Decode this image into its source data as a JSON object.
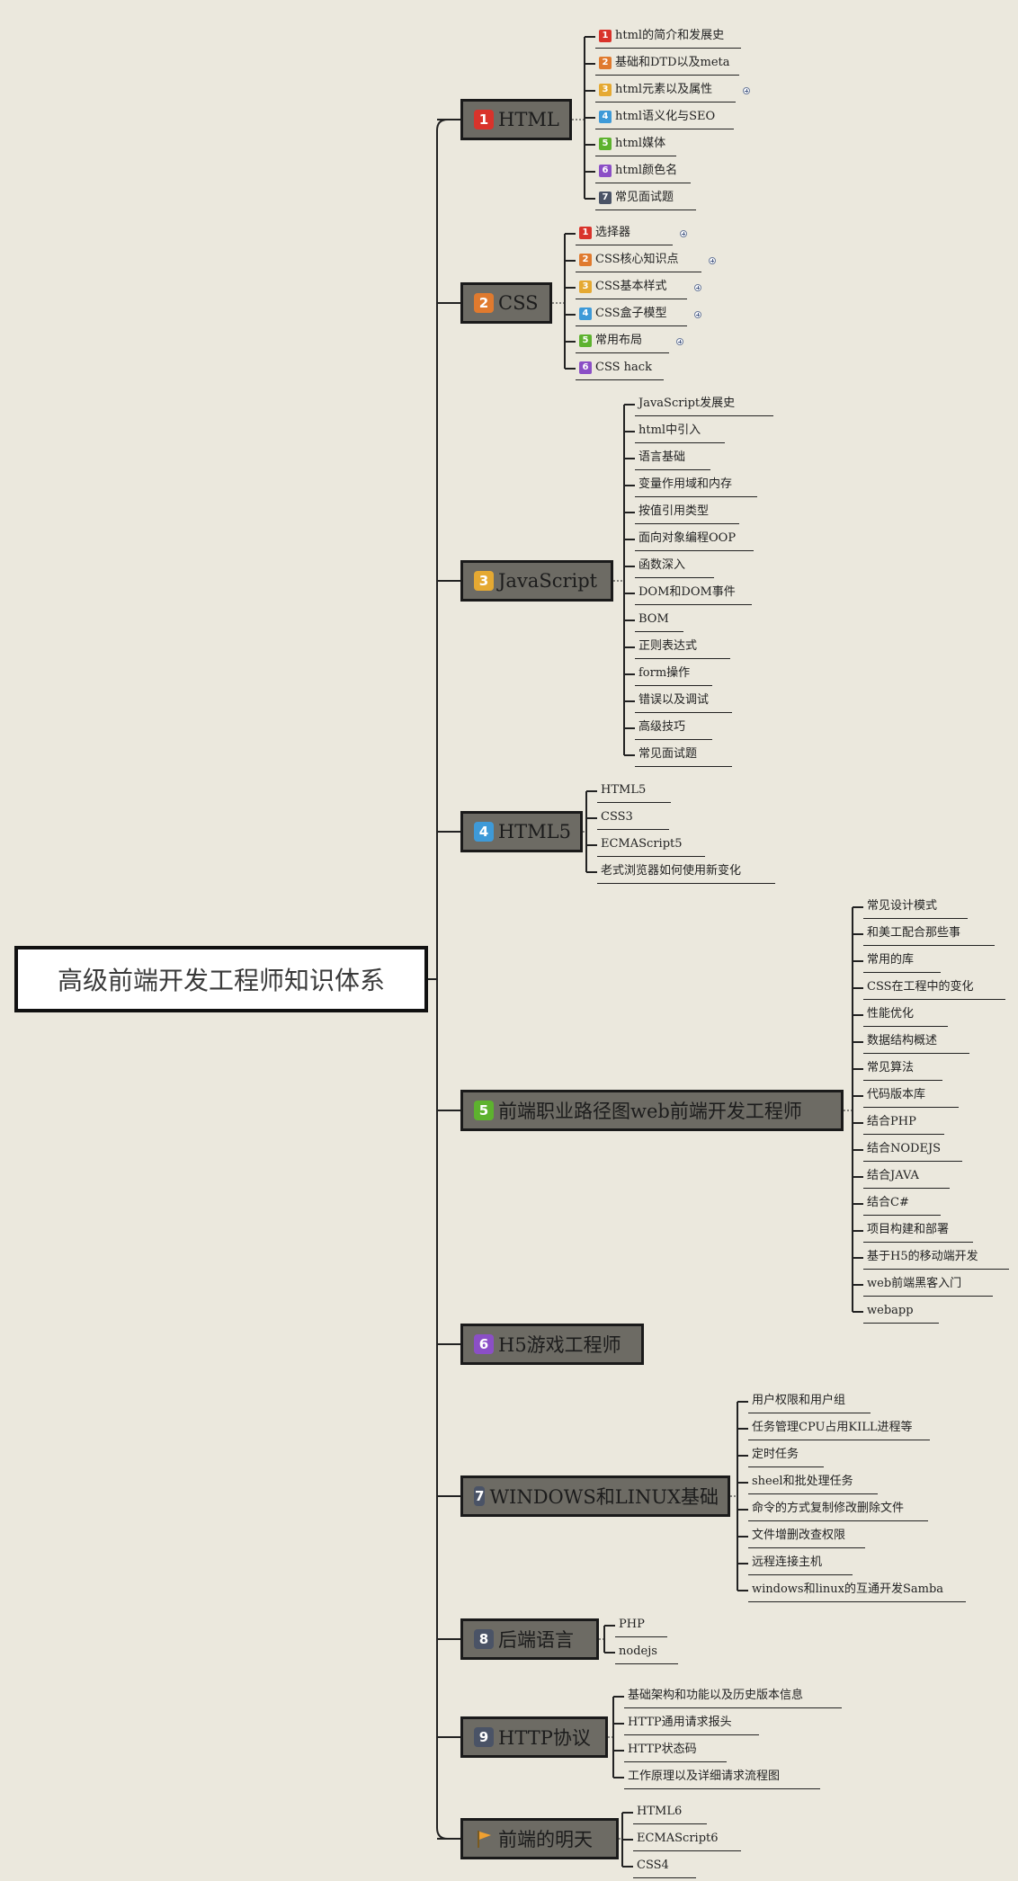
{
  "root": {
    "title": "高级前端开发工程师知识体系"
  },
  "colors": {
    "background": "#ebe8dd",
    "branch_fill": "#6d6b64",
    "line": "#222222",
    "badge": [
      "#d9332b",
      "#e07a2e",
      "#e5a932",
      "#3e9ad8",
      "#5db22e",
      "#8b4fc6",
      "#4a5366",
      "#4a5366",
      "#4a5366"
    ],
    "flag": "#f0a030"
  },
  "branches": [
    {
      "num": "1",
      "label": "HTML",
      "children": [
        {
          "num": "1",
          "label": "html的简介和发展史"
        },
        {
          "num": "2",
          "label": "基础和DTD以及meta"
        },
        {
          "num": "3",
          "label": "html元素以及属性",
          "expandable": true
        },
        {
          "num": "4",
          "label": "html语义化与SEO"
        },
        {
          "num": "5",
          "label": "html媒体"
        },
        {
          "num": "6",
          "label": "html颜色名"
        },
        {
          "num": "7",
          "label": "常见面试题"
        }
      ]
    },
    {
      "num": "2",
      "label": "CSS",
      "children": [
        {
          "num": "1",
          "label": "选择器",
          "expandable": true
        },
        {
          "num": "2",
          "label": "CSS核心知识点",
          "expandable": true
        },
        {
          "num": "3",
          "label": "CSS基本样式",
          "expandable": true
        },
        {
          "num": "4",
          "label": "CSS盒子模型",
          "expandable": true
        },
        {
          "num": "5",
          "label": "常用布局",
          "expandable": true
        },
        {
          "num": "6",
          "label": "CSS hack"
        }
      ]
    },
    {
      "num": "3",
      "label": "JavaScript",
      "children": [
        {
          "label": "JavaScript发展史"
        },
        {
          "label": "html中引入"
        },
        {
          "label": "语言基础"
        },
        {
          "label": "变量作用域和内存"
        },
        {
          "label": "按值引用类型"
        },
        {
          "label": "面向对象编程OOP"
        },
        {
          "label": "函数深入"
        },
        {
          "label": "DOM和DOM事件"
        },
        {
          "label": "BOM"
        },
        {
          "label": "正则表达式"
        },
        {
          "label": "form操作"
        },
        {
          "label": "错误以及调试"
        },
        {
          "label": "高级技巧"
        },
        {
          "label": "常见面试题"
        }
      ]
    },
    {
      "num": "4",
      "label": "HTML5",
      "children": [
        {
          "label": "HTML5"
        },
        {
          "label": "CSS3"
        },
        {
          "label": "ECMAScript5"
        },
        {
          "label": "老式浏览器如何使用新变化"
        }
      ]
    },
    {
      "num": "5",
      "label": "前端职业路径图web前端开发工程师",
      "children": [
        {
          "label": "常见设计模式"
        },
        {
          "label": "和美工配合那些事"
        },
        {
          "label": "常用的库"
        },
        {
          "label": "CSS在工程中的变化"
        },
        {
          "label": "性能优化"
        },
        {
          "label": "数据结构概述"
        },
        {
          "label": "常见算法"
        },
        {
          "label": "代码版本库"
        },
        {
          "label": "结合PHP"
        },
        {
          "label": "结合NODEJS"
        },
        {
          "label": "结合JAVA"
        },
        {
          "label": "结合C#"
        },
        {
          "label": "项目构建和部署"
        },
        {
          "label": "基于H5的移动端开发"
        },
        {
          "label": "web前端黑客入门"
        },
        {
          "label": "webapp"
        }
      ]
    },
    {
      "num": "6",
      "label": "H5游戏工程师",
      "children": []
    },
    {
      "num": "7",
      "label": "WINDOWS和LINUX基础",
      "children": [
        {
          "label": "用户权限和用户组"
        },
        {
          "label": "任务管理CPU占用KILL进程等"
        },
        {
          "label": "定时任务"
        },
        {
          "label": "sheel和批处理任务"
        },
        {
          "label": "命令的方式复制修改删除文件"
        },
        {
          "label": "文件增删改查权限"
        },
        {
          "label": "远程连接主机"
        },
        {
          "label": "windows和linux的互通开发Samba"
        }
      ]
    },
    {
      "num": "8",
      "label": "后端语言",
      "children": [
        {
          "label": "PHP"
        },
        {
          "label": "nodejs"
        }
      ]
    },
    {
      "num": "9",
      "label": "HTTP协议",
      "children": [
        {
          "label": "基础架构和功能以及历史版本信息"
        },
        {
          "label": "HTTP通用请求报头"
        },
        {
          "label": "HTTP状态码"
        },
        {
          "label": "工作原理以及详细请求流程图"
        }
      ]
    },
    {
      "icon": "flag-icon",
      "label": "前端的明天",
      "children": [
        {
          "label": "HTML6"
        },
        {
          "label": "ECMAScript6"
        },
        {
          "label": "CSS4"
        }
      ]
    }
  ]
}
